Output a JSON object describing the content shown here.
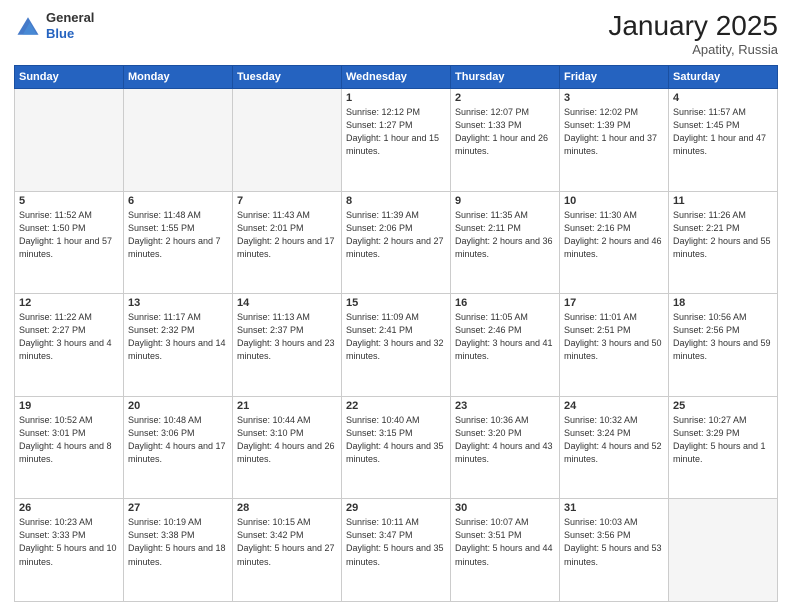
{
  "header": {
    "logo_general": "General",
    "logo_blue": "Blue",
    "title": "January 2025",
    "location": "Apatity, Russia"
  },
  "days_of_week": [
    "Sunday",
    "Monday",
    "Tuesday",
    "Wednesday",
    "Thursday",
    "Friday",
    "Saturday"
  ],
  "weeks": [
    [
      {
        "day": "",
        "text": ""
      },
      {
        "day": "",
        "text": ""
      },
      {
        "day": "",
        "text": ""
      },
      {
        "day": "1",
        "text": "Sunrise: 12:12 PM\nSunset: 1:27 PM\nDaylight: 1 hour and 15 minutes."
      },
      {
        "day": "2",
        "text": "Sunrise: 12:07 PM\nSunset: 1:33 PM\nDaylight: 1 hour and 26 minutes."
      },
      {
        "day": "3",
        "text": "Sunrise: 12:02 PM\nSunset: 1:39 PM\nDaylight: 1 hour and 37 minutes."
      },
      {
        "day": "4",
        "text": "Sunrise: 11:57 AM\nSunset: 1:45 PM\nDaylight: 1 hour and 47 minutes."
      }
    ],
    [
      {
        "day": "5",
        "text": "Sunrise: 11:52 AM\nSunset: 1:50 PM\nDaylight: 1 hour and 57 minutes."
      },
      {
        "day": "6",
        "text": "Sunrise: 11:48 AM\nSunset: 1:55 PM\nDaylight: 2 hours and 7 minutes."
      },
      {
        "day": "7",
        "text": "Sunrise: 11:43 AM\nSunset: 2:01 PM\nDaylight: 2 hours and 17 minutes."
      },
      {
        "day": "8",
        "text": "Sunrise: 11:39 AM\nSunset: 2:06 PM\nDaylight: 2 hours and 27 minutes."
      },
      {
        "day": "9",
        "text": "Sunrise: 11:35 AM\nSunset: 2:11 PM\nDaylight: 2 hours and 36 minutes."
      },
      {
        "day": "10",
        "text": "Sunrise: 11:30 AM\nSunset: 2:16 PM\nDaylight: 2 hours and 46 minutes."
      },
      {
        "day": "11",
        "text": "Sunrise: 11:26 AM\nSunset: 2:21 PM\nDaylight: 2 hours and 55 minutes."
      }
    ],
    [
      {
        "day": "12",
        "text": "Sunrise: 11:22 AM\nSunset: 2:27 PM\nDaylight: 3 hours and 4 minutes."
      },
      {
        "day": "13",
        "text": "Sunrise: 11:17 AM\nSunset: 2:32 PM\nDaylight: 3 hours and 14 minutes."
      },
      {
        "day": "14",
        "text": "Sunrise: 11:13 AM\nSunset: 2:37 PM\nDaylight: 3 hours and 23 minutes."
      },
      {
        "day": "15",
        "text": "Sunrise: 11:09 AM\nSunset: 2:41 PM\nDaylight: 3 hours and 32 minutes."
      },
      {
        "day": "16",
        "text": "Sunrise: 11:05 AM\nSunset: 2:46 PM\nDaylight: 3 hours and 41 minutes."
      },
      {
        "day": "17",
        "text": "Sunrise: 11:01 AM\nSunset: 2:51 PM\nDaylight: 3 hours and 50 minutes."
      },
      {
        "day": "18",
        "text": "Sunrise: 10:56 AM\nSunset: 2:56 PM\nDaylight: 3 hours and 59 minutes."
      }
    ],
    [
      {
        "day": "19",
        "text": "Sunrise: 10:52 AM\nSunset: 3:01 PM\nDaylight: 4 hours and 8 minutes."
      },
      {
        "day": "20",
        "text": "Sunrise: 10:48 AM\nSunset: 3:06 PM\nDaylight: 4 hours and 17 minutes."
      },
      {
        "day": "21",
        "text": "Sunrise: 10:44 AM\nSunset: 3:10 PM\nDaylight: 4 hours and 26 minutes."
      },
      {
        "day": "22",
        "text": "Sunrise: 10:40 AM\nSunset: 3:15 PM\nDaylight: 4 hours and 35 minutes."
      },
      {
        "day": "23",
        "text": "Sunrise: 10:36 AM\nSunset: 3:20 PM\nDaylight: 4 hours and 43 minutes."
      },
      {
        "day": "24",
        "text": "Sunrise: 10:32 AM\nSunset: 3:24 PM\nDaylight: 4 hours and 52 minutes."
      },
      {
        "day": "25",
        "text": "Sunrise: 10:27 AM\nSunset: 3:29 PM\nDaylight: 5 hours and 1 minute."
      }
    ],
    [
      {
        "day": "26",
        "text": "Sunrise: 10:23 AM\nSunset: 3:33 PM\nDaylight: 5 hours and 10 minutes."
      },
      {
        "day": "27",
        "text": "Sunrise: 10:19 AM\nSunset: 3:38 PM\nDaylight: 5 hours and 18 minutes."
      },
      {
        "day": "28",
        "text": "Sunrise: 10:15 AM\nSunset: 3:42 PM\nDaylight: 5 hours and 27 minutes."
      },
      {
        "day": "29",
        "text": "Sunrise: 10:11 AM\nSunset: 3:47 PM\nDaylight: 5 hours and 35 minutes."
      },
      {
        "day": "30",
        "text": "Sunrise: 10:07 AM\nSunset: 3:51 PM\nDaylight: 5 hours and 44 minutes."
      },
      {
        "day": "31",
        "text": "Sunrise: 10:03 AM\nSunset: 3:56 PM\nDaylight: 5 hours and 53 minutes."
      },
      {
        "day": "",
        "text": ""
      }
    ]
  ]
}
